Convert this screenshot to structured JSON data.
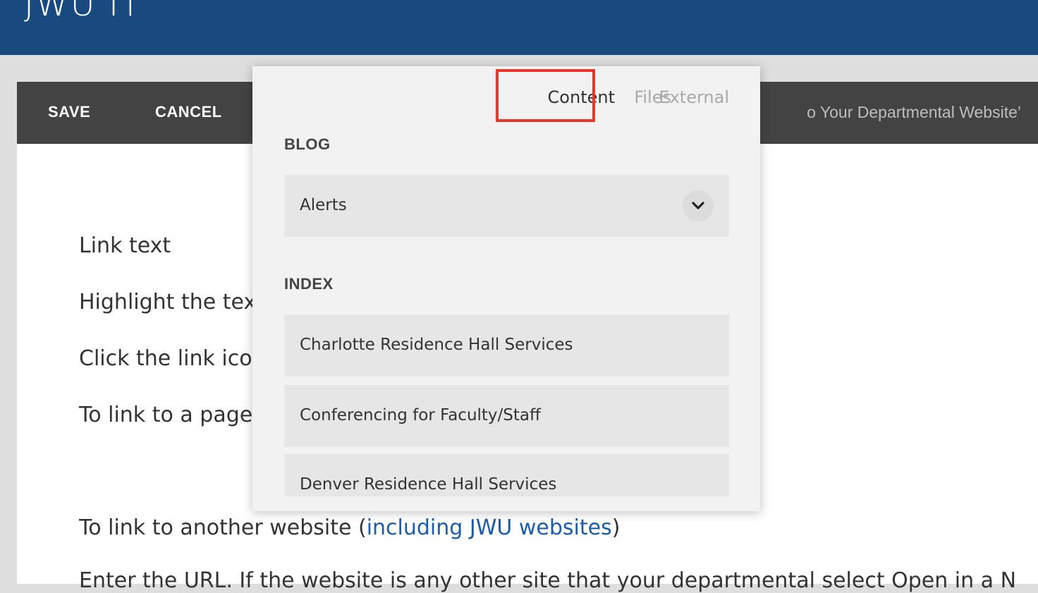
{
  "header": {
    "brand": "JWU IT"
  },
  "toolbar": {
    "save_label": "SAVE",
    "cancel_label": "CANCEL",
    "page_title": "o Your Departmental Website’"
  },
  "content": {
    "lines": [
      "Link text",
      "Highlight the tex",
      "Click the link ico",
      "To link to a page"
    ],
    "external_prefix": "To link to another website (",
    "external_link": "including JWU websites",
    "external_suffix": ")",
    "cut_line": "Enter the URL. If the website is any other site that your departmental select Open in a N"
  },
  "link_popup": {
    "tabs": [
      {
        "label": "Content",
        "active": true
      },
      {
        "label": "Files",
        "active": false
      },
      {
        "label": "External",
        "active": false
      }
    ],
    "sections": [
      {
        "heading": "BLOG",
        "items": [
          "Alerts"
        ]
      },
      {
        "heading": "INDEX",
        "items": [
          "Charlotte Residence Hall Services",
          "Conferencing for Faculty/Staff",
          "Denver Residence Hall Services"
        ]
      }
    ],
    "highlight_color": "#e8372c"
  },
  "icons": {
    "dropdown": "chevron-down-icon"
  },
  "colors": {
    "header_bg": "#184a80",
    "toolbar_bg": "#434343",
    "link": "#1c5ca8"
  }
}
